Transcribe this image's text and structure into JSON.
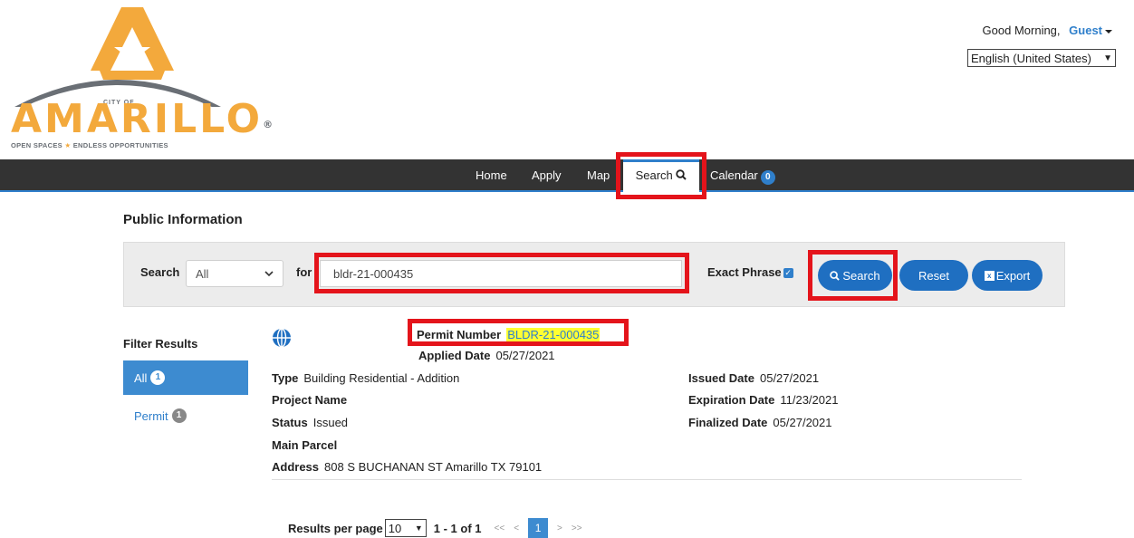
{
  "header": {
    "logo": {
      "city_of": "CITY OF",
      "name": "AMARILLO",
      "registered": "®",
      "tagline_left": "OPEN SPACES",
      "tagline_right": "ENDLESS OPPORTUNITIES"
    },
    "greeting": "Good Morning,",
    "user": "Guest",
    "language": "English (United States)"
  },
  "nav": {
    "home": "Home",
    "apply": "Apply",
    "map": "Map",
    "search": "Search",
    "calendar": "Calendar",
    "calendar_count": "0"
  },
  "page_title": "Public Information",
  "search_panel": {
    "search_label": "Search",
    "category": "All",
    "for_label": "for",
    "query": "bldr-21-000435",
    "exact_phrase_label": "Exact Phrase",
    "exact_phrase_checked": true,
    "search_button": "Search",
    "reset_button": "Reset",
    "export_button": "Export"
  },
  "filters": {
    "title": "Filter Results",
    "items": [
      {
        "label": "All",
        "count": "1"
      },
      {
        "label": "Permit",
        "count": "1"
      }
    ]
  },
  "result": {
    "permit_number_label": "Permit Number",
    "permit_number": "BLDR-21-000435",
    "applied_date_label": "Applied Date",
    "applied_date": "05/27/2021",
    "type_label": "Type",
    "type": "Building Residential - Addition",
    "project_name_label": "Project Name",
    "status_label": "Status",
    "status": "Issued",
    "main_parcel_label": "Main Parcel",
    "address_label": "Address",
    "address": "808 S BUCHANAN ST Amarillo TX 79101",
    "issued_date_label": "Issued Date",
    "issued_date": "05/27/2021",
    "expiration_date_label": "Expiration Date",
    "expiration_date": "11/23/2021",
    "finalized_date_label": "Finalized Date",
    "finalized_date": "05/27/2021"
  },
  "pagination": {
    "results_per_page_label": "Results per page",
    "per_page": "10",
    "range": "1 - 1 of 1",
    "first": "<<",
    "prev": "<",
    "current_page": "1",
    "next": ">",
    "last": ">>"
  },
  "colors": {
    "accent": "#2f7fcb",
    "nav_bg": "#333333",
    "highlight_box": "#e4141b",
    "logo_orange": "#f3a93c",
    "permit_highlight": "#ffff33"
  }
}
